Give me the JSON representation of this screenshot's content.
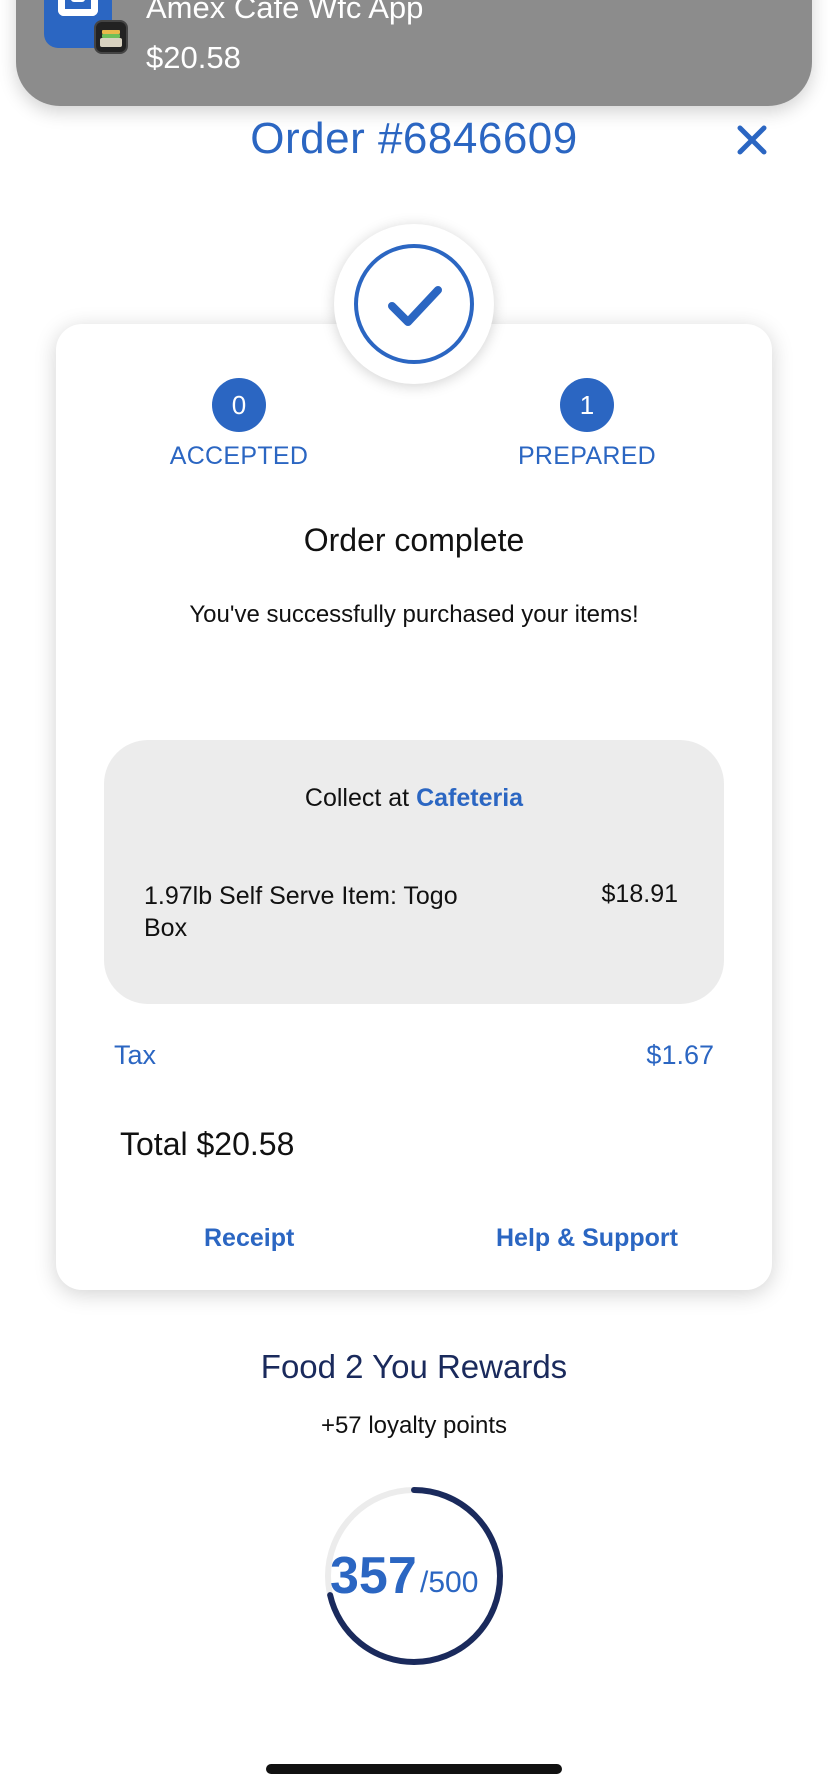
{
  "notification": {
    "app_name": "Amex Cafe Wfc App",
    "amount": "$20.58",
    "app_icon": "cafe-app-icon",
    "wallet_icon": "wallet-icon"
  },
  "header": {
    "title": "Order #6846609",
    "close_icon": "close-icon"
  },
  "status": {
    "check_icon": "checkmark-icon",
    "steps": [
      {
        "number": "0",
        "label": "ACCEPTED"
      },
      {
        "number": "1",
        "label": "PREPARED"
      }
    ],
    "title": "Order complete",
    "subtitle": "You've successfully purchased your items!"
  },
  "collect": {
    "prefix": "Collect at",
    "location": "Cafeteria",
    "items": [
      {
        "name": "1.97lb Self Serve Item: Togo Box",
        "price": "$18.91"
      }
    ]
  },
  "summary": {
    "tax_label": "Tax",
    "tax_value": "$1.67",
    "total": "Total $20.58"
  },
  "actions": {
    "receipt": "Receipt",
    "help": "Help & Support"
  },
  "rewards": {
    "title": "Food 2 You Rewards",
    "points_earned": "+57 loyalty points",
    "current": "357",
    "max": "/500",
    "progress_fraction": 0.714
  },
  "colors": {
    "accent": "#2b66c2",
    "navy": "#1a2a5c",
    "banner": "#8c8c8c",
    "collect_bg": "#ececec"
  }
}
